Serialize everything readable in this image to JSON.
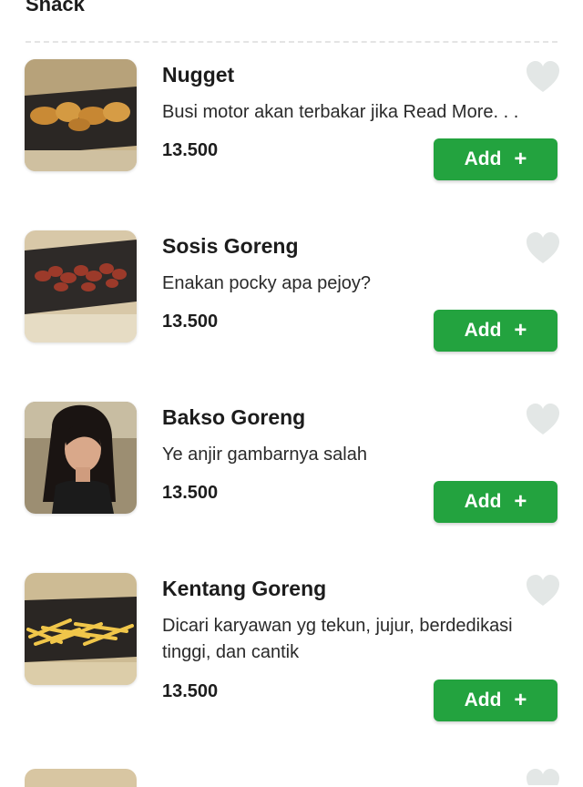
{
  "section": {
    "title": "Snack"
  },
  "items": [
    {
      "name": "Nugget",
      "description": "Busi motor akan terbakar jika Read More. . .",
      "price": "13.500",
      "add_label": "Add",
      "add_icon": "+",
      "image": "nugget-photo",
      "favorite": false
    },
    {
      "name": "Sosis Goreng",
      "description": "Enakan pocky apa pejoy?",
      "price": "13.500",
      "add_label": "Add",
      "add_icon": "+",
      "image": "sausage-photo",
      "favorite": false
    },
    {
      "name": "Bakso Goreng",
      "description": "Ye anjir gambarnya salah",
      "price": "13.500",
      "add_label": "Add",
      "add_icon": "+",
      "image": "portrait-photo",
      "favorite": false
    },
    {
      "name": "Kentang Goreng",
      "description": "Dicari karyawan yg tekun, jujur, berdedikasi tinggi, dan cantik",
      "price": "13.500",
      "add_label": "Add",
      "add_icon": "+",
      "image": "fries-photo",
      "favorite": false
    }
  ],
  "colors": {
    "accent": "#23a33f",
    "heart": "#e3e7e6",
    "divider": "#e4e4e4"
  }
}
